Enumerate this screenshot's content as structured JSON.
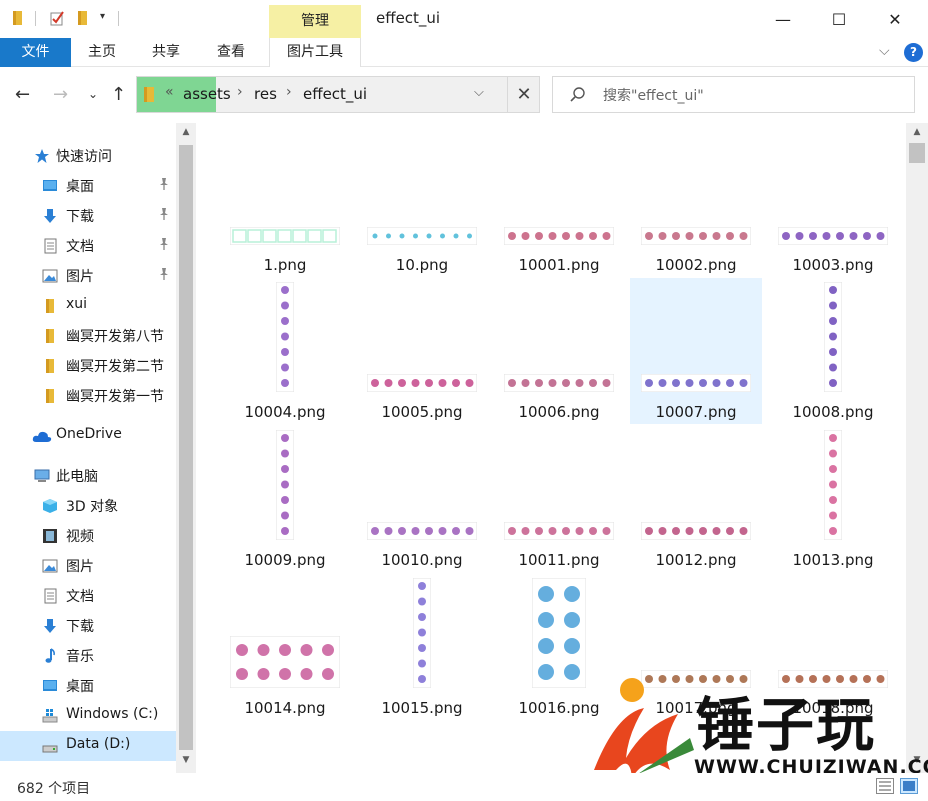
{
  "window": {
    "title": "effect_ui",
    "manage_tab": "管理",
    "minimize": "—",
    "maximize": "☐",
    "close": "✕"
  },
  "ribbon": {
    "file": "文件",
    "tabs": [
      "主页",
      "共享",
      "查看"
    ],
    "picture_tools": "图片工具",
    "help": "?"
  },
  "address": {
    "overflow": "«",
    "crumbs": [
      "assets",
      "res",
      "effect_ui"
    ]
  },
  "search": {
    "placeholder": "搜索\"effect_ui\""
  },
  "sidebar": {
    "quick_access": "快速访问",
    "pinned": [
      "桌面",
      "下载",
      "文档",
      "图片"
    ],
    "folders": [
      "xui",
      "幽冥开发第八节",
      "幽冥开发第二节",
      "幽冥开发第一节"
    ],
    "onedrive": "OneDrive",
    "this_pc": "此电脑",
    "pc_items": [
      "3D 对象",
      "视频",
      "图片",
      "文档",
      "下载",
      "音乐",
      "桌面",
      "Windows (C:)",
      "Data (D:)"
    ]
  },
  "files": [
    {
      "name": "1.png",
      "kind": "h",
      "color": "#b9f0d8"
    },
    {
      "name": "10.png",
      "kind": "h",
      "color": "#45b7d6"
    },
    {
      "name": "10001.png",
      "kind": "h",
      "color": "#c45a7a"
    },
    {
      "name": "10002.png",
      "kind": "h",
      "color": "#c0607a"
    },
    {
      "name": "10003.png",
      "kind": "h",
      "color": "#7a4ab8"
    },
    {
      "name": "10004.png",
      "kind": "v",
      "color": "#8a56c2"
    },
    {
      "name": "10005.png",
      "kind": "h",
      "color": "#c4468a"
    },
    {
      "name": "10006.png",
      "kind": "h",
      "color": "#b85a82"
    },
    {
      "name": "10007.png",
      "kind": "h",
      "color": "#6a5ac4"
    },
    {
      "name": "10008.png",
      "kind": "v",
      "color": "#6a46b8"
    },
    {
      "name": "10009.png",
      "kind": "v",
      "color": "#9a52b8"
    },
    {
      "name": "10010.png",
      "kind": "h",
      "color": "#9a5ab8"
    },
    {
      "name": "10011.png",
      "kind": "h",
      "color": "#c45a8a"
    },
    {
      "name": "10012.png",
      "kind": "h",
      "color": "#b84a7a"
    },
    {
      "name": "10013.png",
      "kind": "v",
      "color": "#d45a92"
    },
    {
      "name": "10014.png",
      "kind": "grid",
      "color": "#c85a9a"
    },
    {
      "name": "10015.png",
      "kind": "v",
      "color": "#7a6ad4"
    },
    {
      "name": "10016.png",
      "kind": "grid2",
      "color": "#4aa0d8"
    },
    {
      "name": "10017.png",
      "kind": "h",
      "color": "#a0603a"
    },
    {
      "name": "10018.png",
      "kind": "h",
      "color": "#a8583a"
    }
  ],
  "status": {
    "count": "682 个项目"
  },
  "watermark": {
    "brand": "锤子玩",
    "url": "WWW.CHUIZIWAN.COM"
  },
  "colors": {
    "accent": "#1979ca",
    "selection": "#cce8ff",
    "manage_tab": "#f6f0a4",
    "address_highlight": "#7fd693",
    "folder": "#e8b938"
  }
}
